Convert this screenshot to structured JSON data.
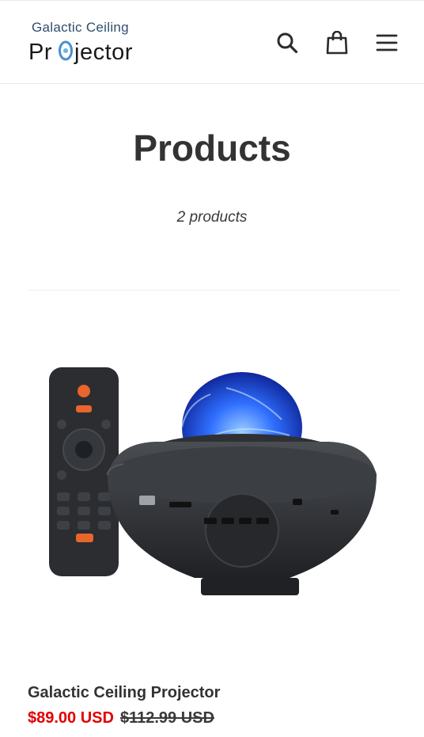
{
  "header": {
    "logo_top": "Galactic Ceiling",
    "logo_bottom": "Projector",
    "icons": [
      "search-icon",
      "cart-icon",
      "menu-icon"
    ]
  },
  "collection": {
    "title": "Products",
    "count": "2 products"
  },
  "products": [
    {
      "title": "Galactic Ceiling Projector",
      "sale_price": "$89.00 USD",
      "regular_price": "$112.99 USD"
    }
  ],
  "colors": {
    "sale": "#e00000",
    "text": "#333333",
    "logo": "#2f4e6b"
  }
}
